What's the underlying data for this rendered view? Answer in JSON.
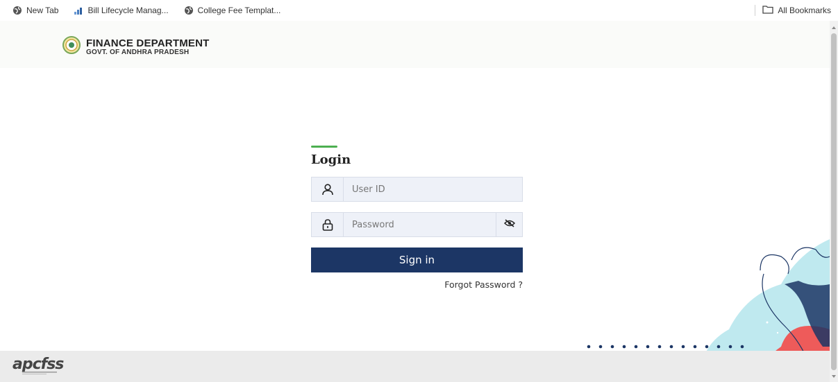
{
  "bookmarks": {
    "items": [
      {
        "label": "New Tab",
        "icon": "globe-icon"
      },
      {
        "label": "Bill Lifecycle Manag...",
        "icon": "chart-icon"
      },
      {
        "label": "College Fee Templat...",
        "icon": "globe-icon"
      }
    ],
    "all_bookmarks_label": "All Bookmarks"
  },
  "header": {
    "title": "FINANCE DEPARTMENT",
    "subtitle": "GOVT. OF ANDHRA PRADESH"
  },
  "login": {
    "title": "Login",
    "user_placeholder": "User ID",
    "password_placeholder": "Password",
    "signin_label": "Sign in",
    "forgot_label": "Forgot Password ?"
  },
  "footer": {
    "logo_text": "apcfss"
  },
  "colors": {
    "primary": "#1c3665",
    "accent": "#4caf50",
    "field_bg": "#eef1f8",
    "footer_bg": "#ebebeb",
    "decor_teal": "#bfe9ef",
    "decor_coral": "#ee5b5a",
    "decor_navy": "#1c3665"
  }
}
